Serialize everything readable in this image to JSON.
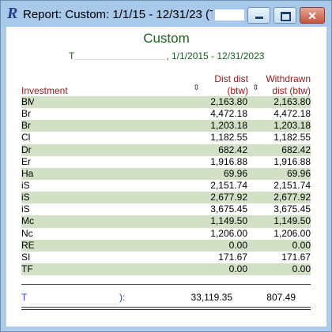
{
  "window": {
    "app_icon": "R",
    "title": "Report: Custom: 1/1/15 - 12/31/23 (T",
    "minimize_icon": "minimize-icon",
    "maximize_icon": "maximize-icon",
    "close_icon": "close-icon",
    "close_glyph": "✕"
  },
  "report": {
    "title": "Custom",
    "subtitle_prefix": "T",
    "subtitle_suffix": ", 1/1/2015 - 12/31/2023"
  },
  "table": {
    "headers": {
      "investment": "Investment",
      "dist_line1": "Dist dist",
      "dist_line2": "(btw)",
      "withdrawn_line1": "Withdrawn",
      "withdrawn_line2": "dist (btw)",
      "sort_glyph": "⇳"
    },
    "rows": [
      {
        "investment": "BM",
        "dist": "2,163.80",
        "withdrawn": "2,163.80"
      },
      {
        "investment": "Br",
        "dist": "4,472.18",
        "withdrawn": "4,472.18"
      },
      {
        "investment": "Br",
        "dist": "1,203.18",
        "withdrawn": "1,203.18"
      },
      {
        "investment": "Cl",
        "dist": "1,182.55",
        "withdrawn": "1,182.55"
      },
      {
        "investment": "Dr",
        "dist": "682.42",
        "withdrawn": "682.42"
      },
      {
        "investment": "Er",
        "dist": "1,916.88",
        "withdrawn": "1,916.88"
      },
      {
        "investment": "Ha",
        "dist": "69.96",
        "withdrawn": "69.96"
      },
      {
        "investment": "iS",
        "dist": "2,151.74",
        "withdrawn": "2,151.74"
      },
      {
        "investment": "iS",
        "dist": "2,677.92",
        "withdrawn": "2,677.92"
      },
      {
        "investment": "iS",
        "dist": "3,675.45",
        "withdrawn": "3,675.45"
      },
      {
        "investment": "Mc",
        "dist": "1,149.50",
        "withdrawn": "1,149.50"
      },
      {
        "investment": "Nc",
        "dist": "1,206.00",
        "withdrawn": "1,206.00"
      },
      {
        "investment": "RE",
        "dist": "0.00",
        "withdrawn": "0.00"
      },
      {
        "investment": "SI",
        "dist": "171.67",
        "withdrawn": "171.67"
      },
      {
        "investment": "TF",
        "dist": "0.00",
        "withdrawn": "0.00"
      }
    ],
    "total": {
      "label_prefix": "T",
      "label_suffix": "):",
      "dist": "33,119.35",
      "withdrawn": "807.49"
    }
  }
}
